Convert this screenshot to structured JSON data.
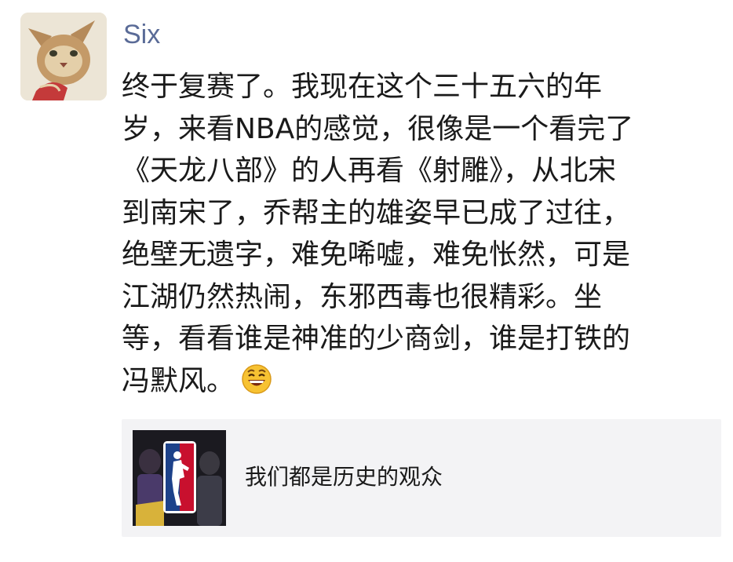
{
  "post": {
    "author": "Six",
    "avatar_icon": "cat-illustration-avatar",
    "lines": [
      "终于复赛了。我现在这个三十五六的年",
      "岁，来看NBA的感觉，很像是一个看完了",
      "《天龙八部》的人再看《射雕》，从北宋",
      "到南宋了，乔帮主的雄姿早已成了过往，",
      "绝壁无遗字，难免唏嘘，难免怅然，可是",
      "江湖仍然热闹，东邪西毒也很精彩。坐",
      "等，看看谁是神准的少商剑，谁是打铁的",
      "冯默风。"
    ],
    "emoji_icon": "grinning-face-emoji"
  },
  "link_card": {
    "title": "我们都是历史的观众",
    "thumbnail_icon": "nba-logo-thumbnail"
  },
  "colors": {
    "author_name": "#5a6b97",
    "text": "#1a1a1a",
    "card_background": "#f3f3f5"
  }
}
